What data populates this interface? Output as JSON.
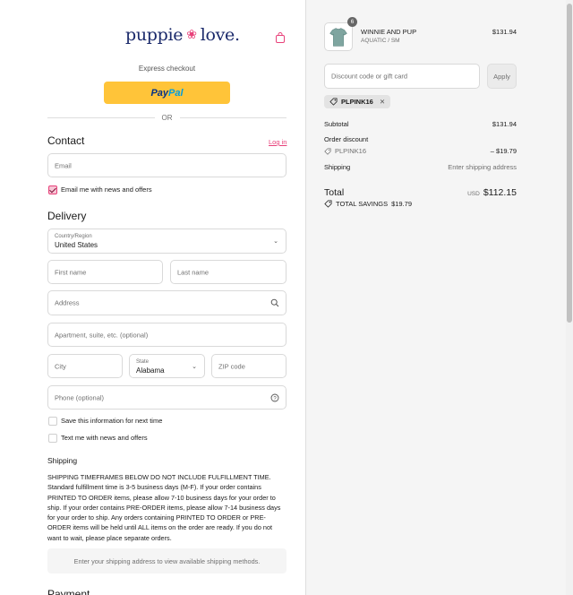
{
  "brand": {
    "name_part1": "puppie",
    "name_part2": "love.",
    "accent": "#e8417a",
    "navy": "#1b2a6b"
  },
  "express_checkout": {
    "label": "Express checkout",
    "paypal_part1": "Pay",
    "paypal_part2": "Pal",
    "or": "OR"
  },
  "contact": {
    "title": "Contact",
    "login": "Log in",
    "email_placeholder": "Email",
    "news_label": "Email me with news and offers",
    "news_checked": true
  },
  "delivery": {
    "title": "Delivery",
    "country_label": "Country/Region",
    "country_value": "United States",
    "first_name": "First name",
    "last_name": "Last name",
    "address": "Address",
    "apartment": "Apartment, suite, etc. (optional)",
    "city": "City",
    "state_label": "State",
    "state_value": "Alabama",
    "zip": "ZIP code",
    "phone": "Phone (optional)",
    "save_info": "Save this information for next time",
    "text_me": "Text me with news and offers"
  },
  "shipping": {
    "title": "Shipping",
    "notice": "SHIPPING TIMEFRAMES BELOW DO NOT INCLUDE FULFILLMENT TIME. Standard fulfillment time is 3-5 business days (M-F). If your order contains PRINTED TO ORDER items, please allow 7-10 business days for your order to ship. If your order contains PRE-ORDER items, please allow 7-14 business days for your order to ship. Any orders containing PRINTED TO ORDER or PRE-ORDER items will be held until ALL items on the order are ready. If you do not want to wait, please place separate orders.",
    "methods_placeholder": "Enter your shipping address to view available shipping methods."
  },
  "payment": {
    "title": "Payment"
  },
  "summary": {
    "product_name": "WINNIE AND PUP",
    "product_variant": "AQUATIC / SM",
    "product_price": "$131.94",
    "quantity": "6",
    "discount_placeholder": "Discount code or gift card",
    "apply": "Apply",
    "applied_code": "PLPINK16",
    "subtotal_label": "Subtotal",
    "subtotal": "$131.94",
    "order_discount_label": "Order discount",
    "discount_code": "PLPINK16",
    "discount_amount": "– $19.79",
    "shipping_label": "Shipping",
    "shipping_value": "Enter shipping address",
    "total_label": "Total",
    "currency": "USD",
    "total": "$112.15",
    "savings_label": "TOTAL SAVINGS",
    "savings": "$19.79"
  }
}
